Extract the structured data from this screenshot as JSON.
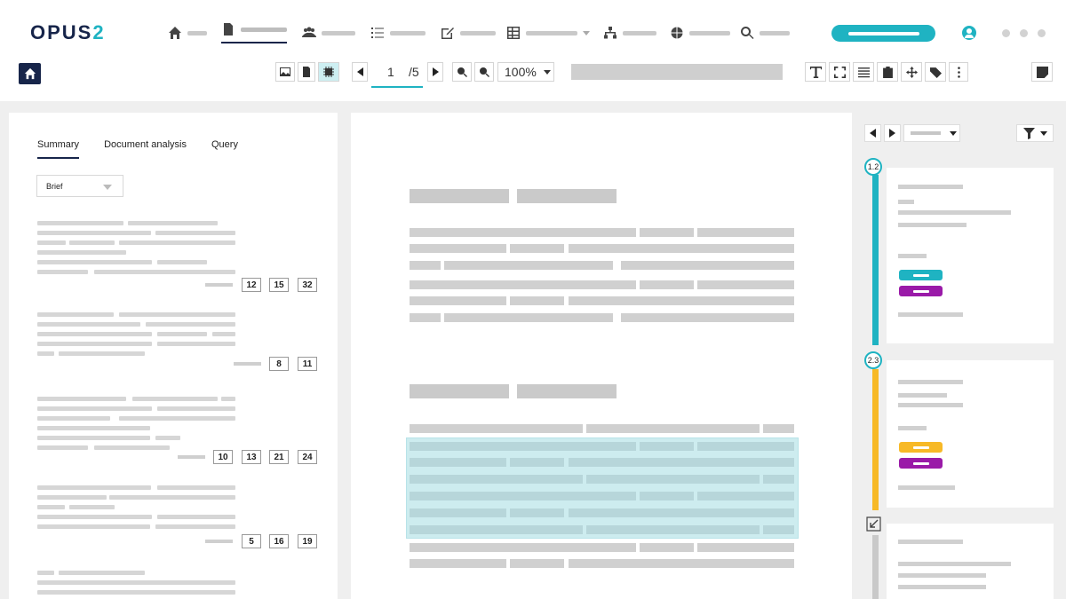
{
  "brand": {
    "logo_main": "OPUS",
    "logo_accent": "2",
    "accent": "#1fb3c2",
    "navy": "#17254a",
    "purple": "#9a1aa8",
    "amber": "#f7b927"
  },
  "nav": {
    "items": [
      {
        "icon": "home-icon"
      },
      {
        "icon": "document-icon",
        "active": true
      },
      {
        "icon": "people-icon"
      },
      {
        "icon": "list-icon"
      },
      {
        "icon": "edit-icon"
      },
      {
        "icon": "grid-icon"
      },
      {
        "icon": "hierarchy-icon"
      },
      {
        "icon": "globe-icon"
      },
      {
        "icon": "search-icon"
      }
    ]
  },
  "toolbar": {
    "page_current": "1",
    "page_total": "/5",
    "zoom": "100%"
  },
  "left_panel": {
    "tabs": [
      "Summary",
      "Document analysis",
      "Query"
    ],
    "active_tab": "Summary",
    "select_value": "Brief",
    "groups": [
      {
        "refs": [
          "12",
          "15",
          "32"
        ]
      },
      {
        "refs": [
          "8",
          "11"
        ]
      },
      {
        "refs": [
          "10",
          "13",
          "21",
          "24"
        ]
      },
      {
        "refs": [
          "5",
          "16",
          "19"
        ]
      }
    ]
  },
  "right_panel": {
    "annotations": [
      {
        "badge": "1.2",
        "color": "#1fb3c2"
      },
      {
        "badge": "2.3",
        "color": "#f7b927"
      }
    ]
  }
}
